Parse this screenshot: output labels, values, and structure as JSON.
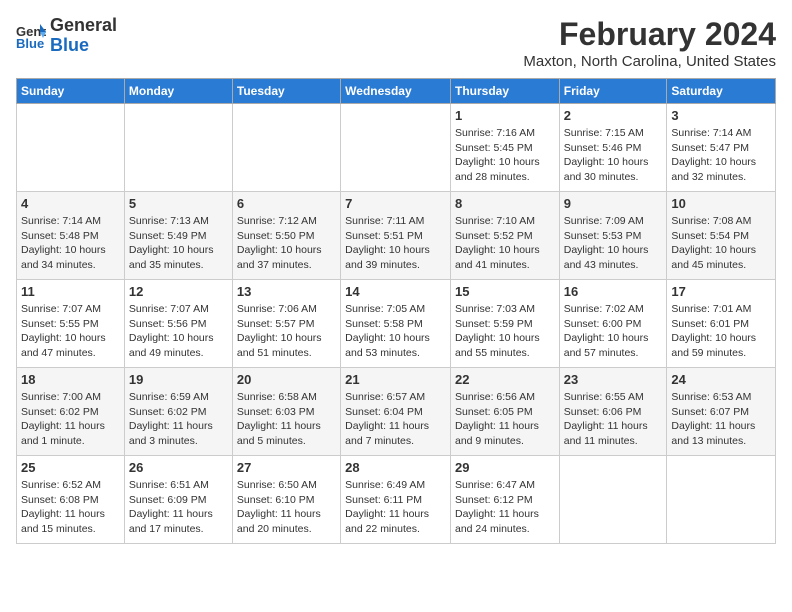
{
  "header": {
    "logo_line1": "General",
    "logo_line2": "Blue",
    "title": "February 2024",
    "subtitle": "Maxton, North Carolina, United States"
  },
  "calendar": {
    "days_of_week": [
      "Sunday",
      "Monday",
      "Tuesday",
      "Wednesday",
      "Thursday",
      "Friday",
      "Saturday"
    ],
    "weeks": [
      [
        {
          "num": "",
          "info": ""
        },
        {
          "num": "",
          "info": ""
        },
        {
          "num": "",
          "info": ""
        },
        {
          "num": "",
          "info": ""
        },
        {
          "num": "1",
          "info": "Sunrise: 7:16 AM\nSunset: 5:45 PM\nDaylight: 10 hours\nand 28 minutes."
        },
        {
          "num": "2",
          "info": "Sunrise: 7:15 AM\nSunset: 5:46 PM\nDaylight: 10 hours\nand 30 minutes."
        },
        {
          "num": "3",
          "info": "Sunrise: 7:14 AM\nSunset: 5:47 PM\nDaylight: 10 hours\nand 32 minutes."
        }
      ],
      [
        {
          "num": "4",
          "info": "Sunrise: 7:14 AM\nSunset: 5:48 PM\nDaylight: 10 hours\nand 34 minutes."
        },
        {
          "num": "5",
          "info": "Sunrise: 7:13 AM\nSunset: 5:49 PM\nDaylight: 10 hours\nand 35 minutes."
        },
        {
          "num": "6",
          "info": "Sunrise: 7:12 AM\nSunset: 5:50 PM\nDaylight: 10 hours\nand 37 minutes."
        },
        {
          "num": "7",
          "info": "Sunrise: 7:11 AM\nSunset: 5:51 PM\nDaylight: 10 hours\nand 39 minutes."
        },
        {
          "num": "8",
          "info": "Sunrise: 7:10 AM\nSunset: 5:52 PM\nDaylight: 10 hours\nand 41 minutes."
        },
        {
          "num": "9",
          "info": "Sunrise: 7:09 AM\nSunset: 5:53 PM\nDaylight: 10 hours\nand 43 minutes."
        },
        {
          "num": "10",
          "info": "Sunrise: 7:08 AM\nSunset: 5:54 PM\nDaylight: 10 hours\nand 45 minutes."
        }
      ],
      [
        {
          "num": "11",
          "info": "Sunrise: 7:07 AM\nSunset: 5:55 PM\nDaylight: 10 hours\nand 47 minutes."
        },
        {
          "num": "12",
          "info": "Sunrise: 7:07 AM\nSunset: 5:56 PM\nDaylight: 10 hours\nand 49 minutes."
        },
        {
          "num": "13",
          "info": "Sunrise: 7:06 AM\nSunset: 5:57 PM\nDaylight: 10 hours\nand 51 minutes."
        },
        {
          "num": "14",
          "info": "Sunrise: 7:05 AM\nSunset: 5:58 PM\nDaylight: 10 hours\nand 53 minutes."
        },
        {
          "num": "15",
          "info": "Sunrise: 7:03 AM\nSunset: 5:59 PM\nDaylight: 10 hours\nand 55 minutes."
        },
        {
          "num": "16",
          "info": "Sunrise: 7:02 AM\nSunset: 6:00 PM\nDaylight: 10 hours\nand 57 minutes."
        },
        {
          "num": "17",
          "info": "Sunrise: 7:01 AM\nSunset: 6:01 PM\nDaylight: 10 hours\nand 59 minutes."
        }
      ],
      [
        {
          "num": "18",
          "info": "Sunrise: 7:00 AM\nSunset: 6:02 PM\nDaylight: 11 hours\nand 1 minute."
        },
        {
          "num": "19",
          "info": "Sunrise: 6:59 AM\nSunset: 6:02 PM\nDaylight: 11 hours\nand 3 minutes."
        },
        {
          "num": "20",
          "info": "Sunrise: 6:58 AM\nSunset: 6:03 PM\nDaylight: 11 hours\nand 5 minutes."
        },
        {
          "num": "21",
          "info": "Sunrise: 6:57 AM\nSunset: 6:04 PM\nDaylight: 11 hours\nand 7 minutes."
        },
        {
          "num": "22",
          "info": "Sunrise: 6:56 AM\nSunset: 6:05 PM\nDaylight: 11 hours\nand 9 minutes."
        },
        {
          "num": "23",
          "info": "Sunrise: 6:55 AM\nSunset: 6:06 PM\nDaylight: 11 hours\nand 11 minutes."
        },
        {
          "num": "24",
          "info": "Sunrise: 6:53 AM\nSunset: 6:07 PM\nDaylight: 11 hours\nand 13 minutes."
        }
      ],
      [
        {
          "num": "25",
          "info": "Sunrise: 6:52 AM\nSunset: 6:08 PM\nDaylight: 11 hours\nand 15 minutes."
        },
        {
          "num": "26",
          "info": "Sunrise: 6:51 AM\nSunset: 6:09 PM\nDaylight: 11 hours\nand 17 minutes."
        },
        {
          "num": "27",
          "info": "Sunrise: 6:50 AM\nSunset: 6:10 PM\nDaylight: 11 hours\nand 20 minutes."
        },
        {
          "num": "28",
          "info": "Sunrise: 6:49 AM\nSunset: 6:11 PM\nDaylight: 11 hours\nand 22 minutes."
        },
        {
          "num": "29",
          "info": "Sunrise: 6:47 AM\nSunset: 6:12 PM\nDaylight: 11 hours\nand 24 minutes."
        },
        {
          "num": "",
          "info": ""
        },
        {
          "num": "",
          "info": ""
        }
      ]
    ]
  }
}
